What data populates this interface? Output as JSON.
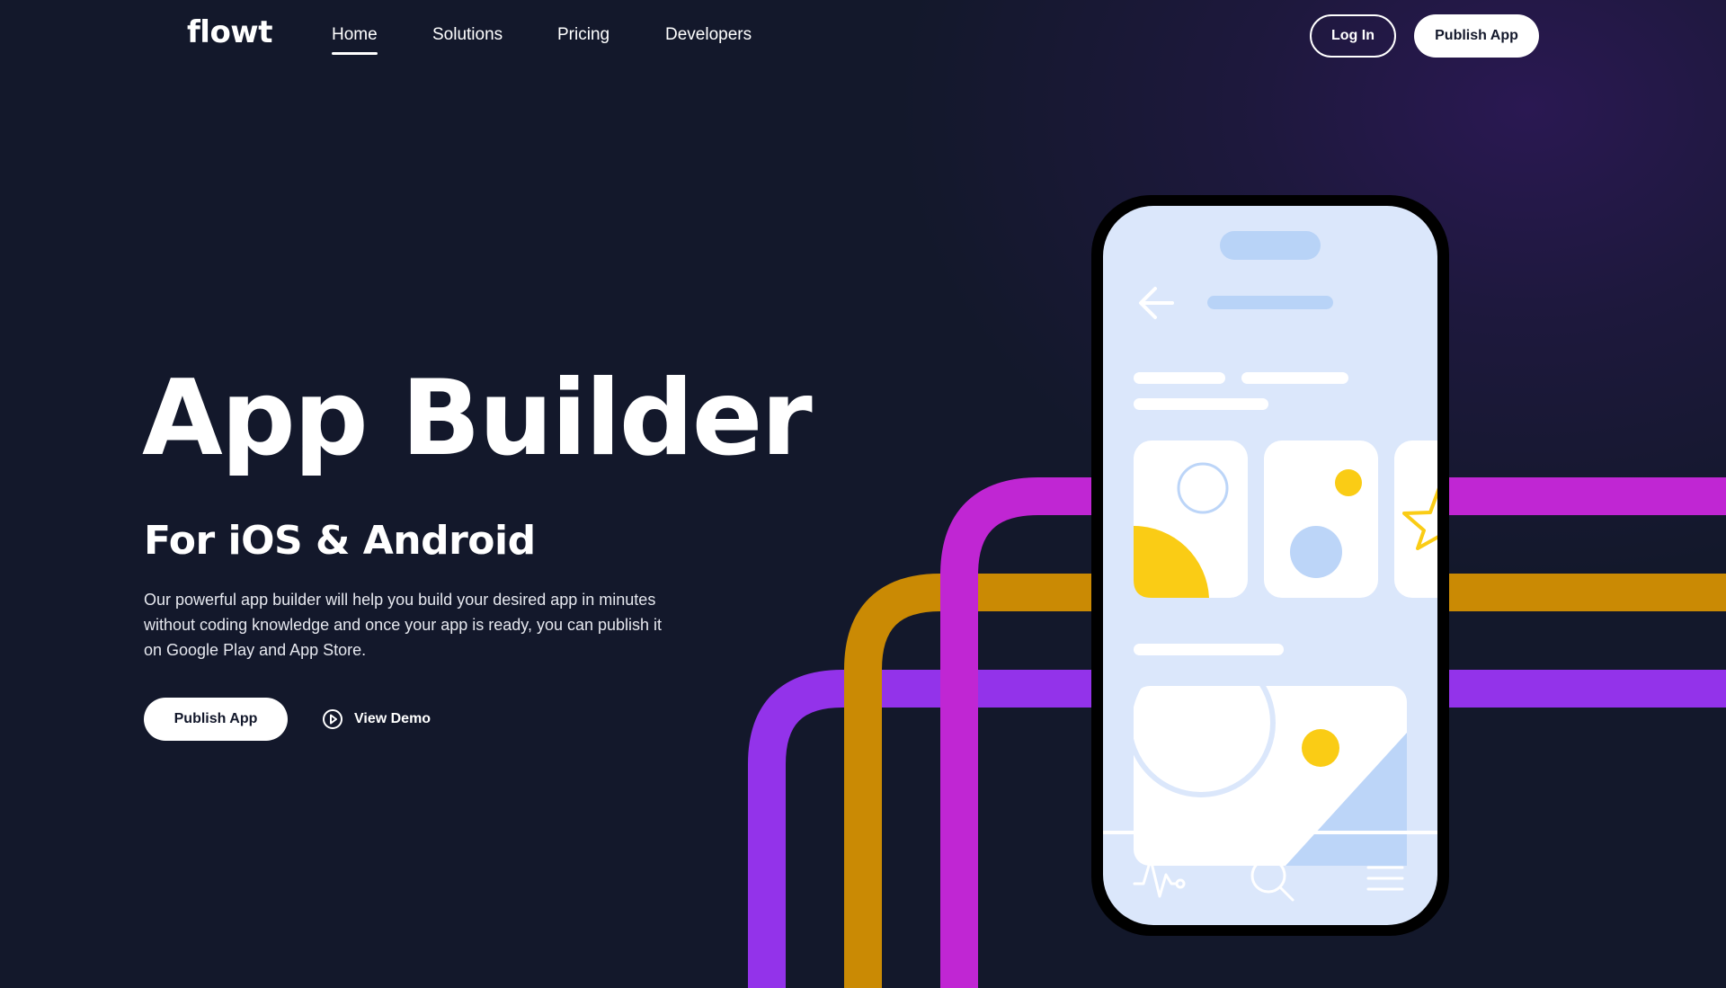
{
  "brand": {
    "logo_text": "flowt"
  },
  "nav": {
    "links": [
      {
        "label": "Home",
        "active": true
      },
      {
        "label": "Solutions",
        "active": false
      },
      {
        "label": "Pricing",
        "active": false
      },
      {
        "label": "Developers",
        "active": false
      }
    ],
    "login_label": "Log In",
    "publish_label": "Publish App"
  },
  "hero": {
    "title": "App Builder",
    "subtitle": "For iOS & Android",
    "description": "Our powerful app builder will help you build your desired app in minutes without coding knowledge and once your app is ready, you can publish it on Google Play and App Store.",
    "primary_cta": "Publish App",
    "secondary_cta": "View Demo",
    "secondary_cta_icon": "play-circle-icon"
  },
  "illustration": {
    "pipe_colors": {
      "magenta": "#c026d3",
      "gold": "#ca8a04",
      "violet": "#9333ea"
    },
    "phone_screen_color": "#dbe7fb",
    "accent_yellow": "#facc15",
    "icons": [
      "back-arrow-icon",
      "pulse-icon",
      "search-icon",
      "menu-icon",
      "star-icon"
    ]
  },
  "colors": {
    "background": "#13182b",
    "glow": "#2a1852",
    "text": "#ffffff",
    "button_bg": "#ffffff",
    "button_text": "#13182b"
  }
}
